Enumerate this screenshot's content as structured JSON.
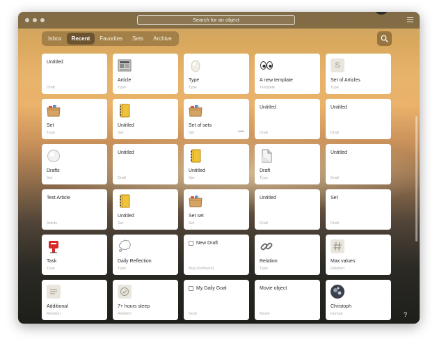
{
  "window": {
    "search_placeholder": "Search for an object",
    "help_label": "?"
  },
  "tabs": [
    {
      "label": "Inbox",
      "active": false
    },
    {
      "label": "Recent",
      "active": true
    },
    {
      "label": "Favorites",
      "active": false
    },
    {
      "label": "Sets",
      "active": false
    },
    {
      "label": "Archive",
      "active": false
    }
  ],
  "cards": [
    {
      "title": "Untitled",
      "type": "Draft",
      "icon": "none"
    },
    {
      "title": "Article",
      "type": "Type",
      "icon": "newspaper-icon"
    },
    {
      "title": "Type",
      "type": "Type",
      "icon": "egg-icon"
    },
    {
      "title": "A new template",
      "type": "Template",
      "icon": "eyes-icon"
    },
    {
      "title": "Set of Articles",
      "type": "Type",
      "icon": "letter-s-icon"
    },
    {
      "title": "Set",
      "type": "Type",
      "icon": "file-box-icon"
    },
    {
      "title": "Untitled",
      "type": "Set",
      "icon": "notebook-icon"
    },
    {
      "title": "Set of sets",
      "type": "Set",
      "icon": "file-box-icon",
      "more": "•••"
    },
    {
      "title": "Untitled",
      "type": "Draft",
      "icon": "none"
    },
    {
      "title": "Untitled",
      "type": "Draft",
      "icon": "none"
    },
    {
      "title": "Drafts",
      "type": "Set",
      "icon": "white-circle-icon"
    },
    {
      "title": "Untitled",
      "type": "Draft",
      "icon": "none"
    },
    {
      "title": "Untitled",
      "type": "Set",
      "icon": "notebook-icon"
    },
    {
      "title": "Draft",
      "type": "Type",
      "icon": "page-icon"
    },
    {
      "title": "Untitled",
      "type": "Draft",
      "icon": "none"
    },
    {
      "title": "Test Article",
      "type": "Article",
      "icon": "none"
    },
    {
      "title": "Untitled",
      "type": "Set",
      "icon": "notebook-icon"
    },
    {
      "title": "Set set",
      "type": "Set",
      "icon": "file-box-icon"
    },
    {
      "title": "Untitled",
      "type": "Draft",
      "icon": "none"
    },
    {
      "title": "Set",
      "type": "Draft",
      "icon": "none"
    },
    {
      "title": "Task",
      "type": "Type",
      "icon": "postbox-icon"
    },
    {
      "title": "Daily Reflection",
      "type": "Type",
      "icon": "thought-balloon-icon"
    },
    {
      "title": "New Draft",
      "type": "Bug (Software)",
      "icon": "checkbox-icon"
    },
    {
      "title": "Relation",
      "type": "Type",
      "icon": "chain-icon"
    },
    {
      "title": "Max values",
      "type": "Relation",
      "icon": "hash-icon"
    },
    {
      "title": "Additional",
      "type": "Relation",
      "icon": "lines-icon"
    },
    {
      "title": "7+ hours sleep",
      "type": "Relation",
      "icon": "check-circle-icon"
    },
    {
      "title": "My Daily Goal",
      "type": "Goal",
      "icon": "checkbox-icon"
    },
    {
      "title": "Movie object",
      "type": "Movie",
      "icon": "none"
    },
    {
      "title": "Christoph",
      "type": "Human",
      "icon": "avatar-icon"
    }
  ],
  "letter_s": "S"
}
